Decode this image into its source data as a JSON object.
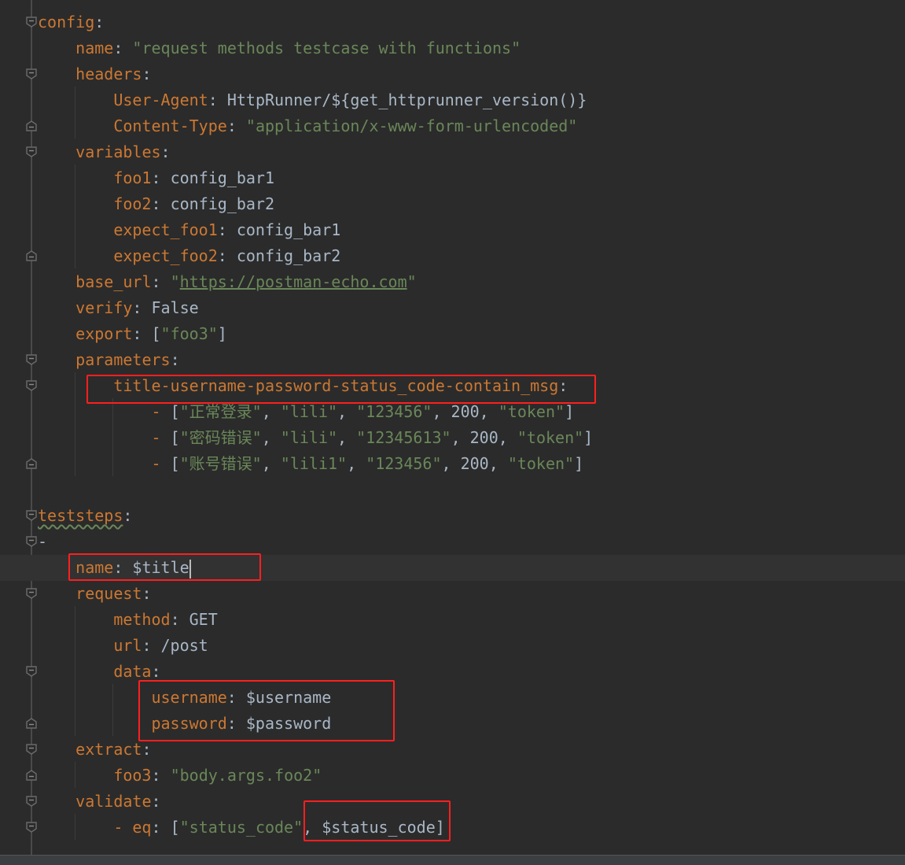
{
  "editor": {
    "language": "yaml",
    "colors": {
      "background": "#2b2b2b",
      "key": "#cc7832",
      "string": "#6a8759",
      "plain": "#a9b7c6",
      "highlight_box": "#ff1f1f"
    },
    "current_line": 21,
    "lines": [
      {
        "indent": 0,
        "fold": "open",
        "tokens": [
          [
            "k",
            "config"
          ],
          [
            "p",
            ":"
          ]
        ]
      },
      {
        "indent": 4,
        "tokens": [
          [
            "k",
            "name"
          ],
          [
            "p",
            ": "
          ],
          [
            "s",
            "\"request methods testcase with functions\""
          ]
        ]
      },
      {
        "indent": 4,
        "fold": "open",
        "tokens": [
          [
            "k",
            "headers"
          ],
          [
            "p",
            ":"
          ]
        ]
      },
      {
        "indent": 8,
        "tokens": [
          [
            "k",
            "User-Agent"
          ],
          [
            "p",
            ": HttpRunner/${get_httprunner_version()}"
          ]
        ]
      },
      {
        "indent": 8,
        "fold": "end",
        "tokens": [
          [
            "k",
            "Content-Type"
          ],
          [
            "p",
            ": "
          ],
          [
            "s",
            "\"application/x-www-form-urlencoded\""
          ]
        ]
      },
      {
        "indent": 4,
        "fold": "open",
        "tokens": [
          [
            "k",
            "variables"
          ],
          [
            "p",
            ":"
          ]
        ]
      },
      {
        "indent": 8,
        "tokens": [
          [
            "k",
            "foo1"
          ],
          [
            "p",
            ": config_bar1"
          ]
        ]
      },
      {
        "indent": 8,
        "tokens": [
          [
            "k",
            "foo2"
          ],
          [
            "p",
            ": config_bar2"
          ]
        ]
      },
      {
        "indent": 8,
        "tokens": [
          [
            "k",
            "expect_foo1"
          ],
          [
            "p",
            ": config_bar1"
          ]
        ]
      },
      {
        "indent": 8,
        "fold": "end",
        "tokens": [
          [
            "k",
            "expect_foo2"
          ],
          [
            "p",
            ": config_bar2"
          ]
        ]
      },
      {
        "indent": 4,
        "tokens": [
          [
            "k",
            "base_url"
          ],
          [
            "p",
            ": "
          ],
          [
            "s",
            "\""
          ],
          [
            "u",
            "https://postman-echo.com"
          ],
          [
            "s",
            "\""
          ]
        ]
      },
      {
        "indent": 4,
        "tokens": [
          [
            "k",
            "verify"
          ],
          [
            "p",
            ": False"
          ]
        ]
      },
      {
        "indent": 4,
        "tokens": [
          [
            "k",
            "export"
          ],
          [
            "p",
            ": ["
          ],
          [
            "s",
            "\"foo3\""
          ],
          [
            "p",
            "]"
          ]
        ]
      },
      {
        "indent": 4,
        "fold": "open",
        "tokens": [
          [
            "k",
            "parameters"
          ],
          [
            "p",
            ":"
          ]
        ]
      },
      {
        "indent": 8,
        "fold": "open",
        "tokens": [
          [
            "k",
            "title-username-password-status_code-contain_msg"
          ],
          [
            "p",
            ":"
          ]
        ]
      },
      {
        "indent": 12,
        "tokens": [
          [
            "k",
            "- "
          ],
          [
            "p",
            "["
          ],
          [
            "s",
            "\"正常登录\""
          ],
          [
            "p",
            ", "
          ],
          [
            "s",
            "\"lili\""
          ],
          [
            "p",
            ", "
          ],
          [
            "s",
            "\"123456\""
          ],
          [
            "p",
            ", 200, "
          ],
          [
            "s",
            "\"token\""
          ],
          [
            "p",
            "]"
          ]
        ]
      },
      {
        "indent": 12,
        "tokens": [
          [
            "k",
            "- "
          ],
          [
            "p",
            "["
          ],
          [
            "s",
            "\"密码错误\""
          ],
          [
            "p",
            ", "
          ],
          [
            "s",
            "\"lili\""
          ],
          [
            "p",
            ", "
          ],
          [
            "s",
            "\"12345613\""
          ],
          [
            "p",
            ", 200, "
          ],
          [
            "s",
            "\"token\""
          ],
          [
            "p",
            "]"
          ]
        ]
      },
      {
        "indent": 12,
        "fold": "end",
        "tokens": [
          [
            "k",
            "- "
          ],
          [
            "p",
            "["
          ],
          [
            "s",
            "\"账号错误\""
          ],
          [
            "p",
            ", "
          ],
          [
            "s",
            "\"lili1\""
          ],
          [
            "p",
            ", "
          ],
          [
            "s",
            "\"123456\""
          ],
          [
            "p",
            ", 200, "
          ],
          [
            "s",
            "\"token\""
          ],
          [
            "p",
            "]"
          ]
        ]
      },
      {
        "indent": 0,
        "tokens": []
      },
      {
        "indent": 0,
        "fold": "open",
        "tokens": [
          [
            "w",
            "teststeps"
          ],
          [
            "p",
            ":"
          ]
        ]
      },
      {
        "indent": 0,
        "fold": "open",
        "tokens": [
          [
            "p",
            "-"
          ]
        ]
      },
      {
        "indent": 4,
        "caret": true,
        "tokens": [
          [
            "k",
            "name"
          ],
          [
            "p",
            ": $title"
          ]
        ]
      },
      {
        "indent": 4,
        "fold": "open",
        "tokens": [
          [
            "k",
            "request"
          ],
          [
            "p",
            ":"
          ]
        ]
      },
      {
        "indent": 8,
        "tokens": [
          [
            "k",
            "method"
          ],
          [
            "p",
            ": GET"
          ]
        ]
      },
      {
        "indent": 8,
        "tokens": [
          [
            "k",
            "url"
          ],
          [
            "p",
            ": /post"
          ]
        ]
      },
      {
        "indent": 8,
        "fold": "open",
        "tokens": [
          [
            "k",
            "data"
          ],
          [
            "p",
            ":"
          ]
        ]
      },
      {
        "indent": 12,
        "tokens": [
          [
            "k",
            "username"
          ],
          [
            "p",
            ": $username"
          ]
        ]
      },
      {
        "indent": 12,
        "fold": "end",
        "tokens": [
          [
            "k",
            "password"
          ],
          [
            "p",
            ": $password"
          ]
        ]
      },
      {
        "indent": 4,
        "fold": "open",
        "tokens": [
          [
            "k",
            "extract"
          ],
          [
            "p",
            ":"
          ]
        ]
      },
      {
        "indent": 8,
        "fold": "end",
        "tokens": [
          [
            "k",
            "foo3"
          ],
          [
            "p",
            ": "
          ],
          [
            "s",
            "\"body.args.foo2\""
          ]
        ]
      },
      {
        "indent": 4,
        "fold": "open",
        "tokens": [
          [
            "k",
            "validate"
          ],
          [
            "p",
            ":"
          ]
        ]
      },
      {
        "indent": 8,
        "fold": "open",
        "tokens": [
          [
            "k",
            "- eq"
          ],
          [
            "p",
            ": ["
          ],
          [
            "s",
            "\"status_code\""
          ],
          [
            "p",
            ", $status_code]"
          ]
        ]
      }
    ]
  }
}
